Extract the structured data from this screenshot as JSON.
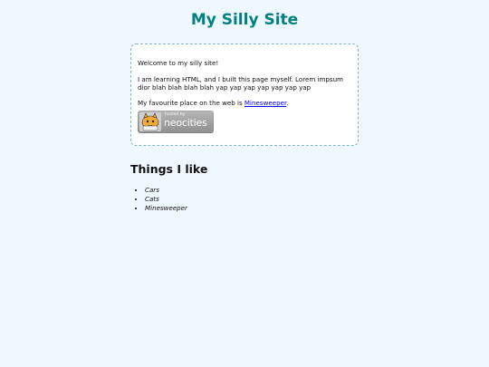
{
  "header": {
    "title": "My Silly Site"
  },
  "intro": {
    "welcome": "Welcome to my silly site!",
    "description": "I am learning HTML, and I built this page myself. Lorem impsum dior blah blah blah blah yap yap yap yap yap yap yap",
    "favourite_prefix": "My favourite place on the web is ",
    "favourite_link": "Minesweeper",
    "favourite_suffix": "."
  },
  "badge": {
    "hosted_by": "hosted by",
    "brand": "neocities",
    "icon": "neocities-cat-icon"
  },
  "likes": {
    "heading": "Things I like",
    "items": [
      "Cars",
      "Cats",
      "Minesweeper"
    ]
  },
  "colors": {
    "background": "#f0f8ff",
    "title": "#008080",
    "link": "#0000ee",
    "border": "#7fb6c7"
  }
}
